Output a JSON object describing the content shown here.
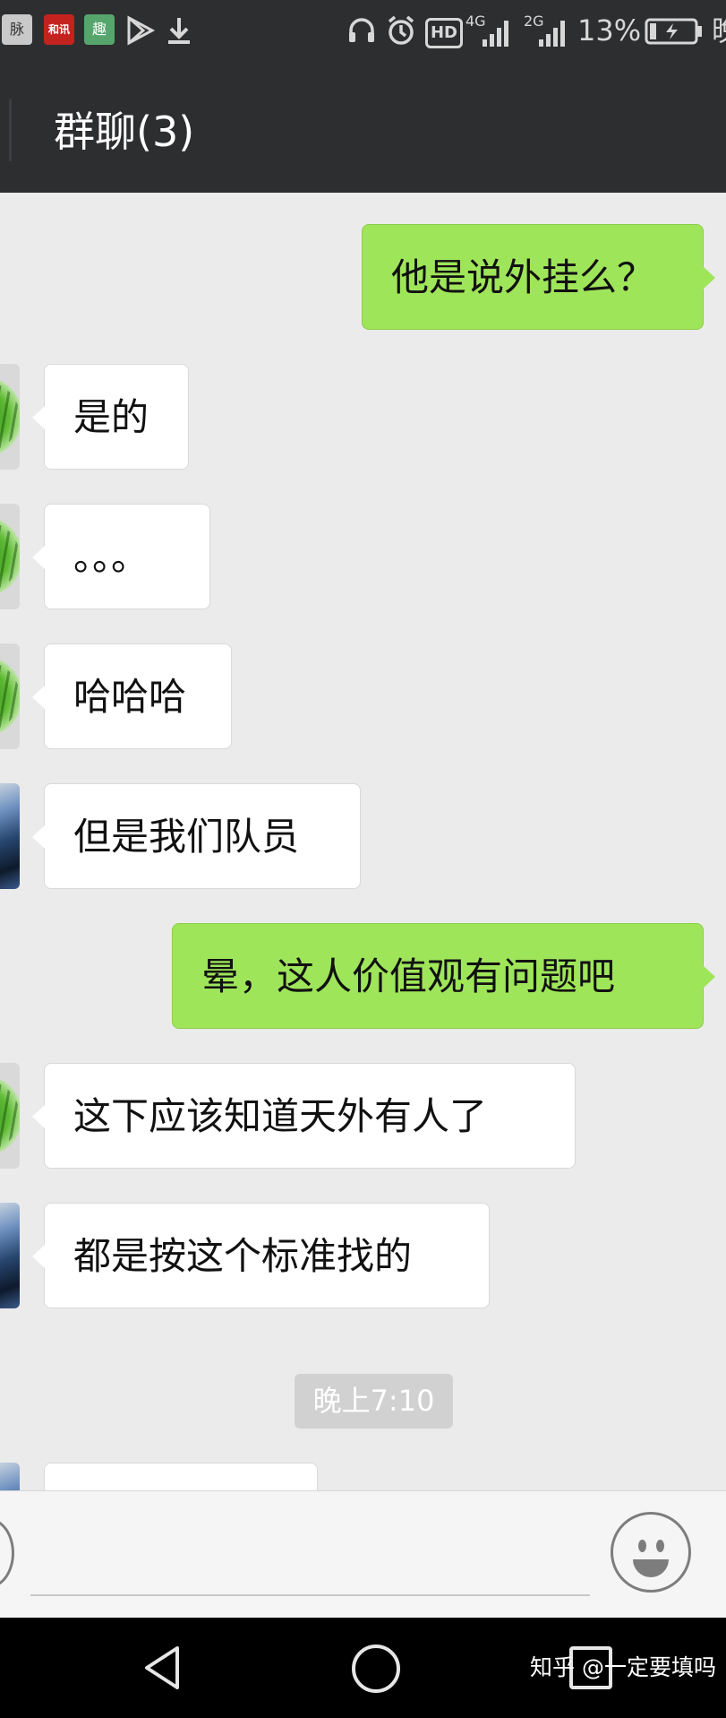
{
  "status_bar": {
    "app_icons": [
      {
        "name": "maimai-app-icon",
        "label": "脉"
      },
      {
        "name": "hexun-app-icon",
        "label": "和讯"
      },
      {
        "name": "qutoutiao-app-icon",
        "label": "趣"
      }
    ],
    "mobile_network": "4G",
    "sim2_network": "2G",
    "hd_label": "HD",
    "battery": "13%",
    "clipped_text": "晚"
  },
  "header": {
    "title": "群聊(3)"
  },
  "messages": [
    {
      "direction": "out",
      "text": "他是说外挂么？"
    },
    {
      "direction": "in",
      "avatar": "melon-avatar",
      "text": "是的"
    },
    {
      "direction": "in",
      "avatar": "melon-avatar",
      "text": "。。。"
    },
    {
      "direction": "in",
      "avatar": "melon-avatar",
      "text": "哈哈哈"
    },
    {
      "direction": "in",
      "avatar": "photo-avatar",
      "text": "但是我们队员"
    },
    {
      "direction": "out",
      "text": "晕，这人价值观有问题吧"
    },
    {
      "direction": "in",
      "avatar": "melon-avatar",
      "text": "这下应该知道天外有人了"
    },
    {
      "direction": "in",
      "avatar": "photo-avatar",
      "text": "都是按这个标准找的"
    }
  ],
  "timestamp": "晚上7:10",
  "watermark": "知乎 @一定要填吗",
  "colors": {
    "header_bg": "#2d2e30",
    "chat_bg": "#ebebeb",
    "outgoing_bubble": "#9fe55a",
    "incoming_bubble": "#ffffff"
  }
}
